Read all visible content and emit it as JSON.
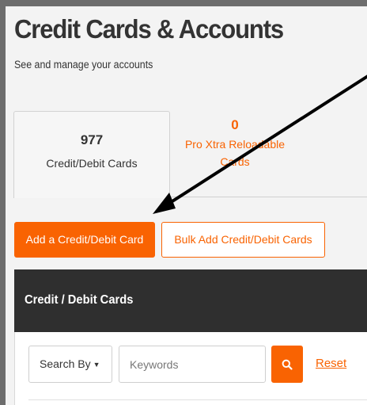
{
  "page": {
    "title": "Credit Cards & Accounts",
    "subtitle": "See and manage your accounts"
  },
  "tabs": [
    {
      "count": "977",
      "label": "Credit/Debit Cards",
      "active": true
    },
    {
      "count": "0",
      "label": "Pro Xtra Reloadable Cards",
      "active": false
    }
  ],
  "actions": {
    "add_label": "Add a Credit/Debit Card",
    "bulk_label": "Bulk Add Credit/Debit Cards"
  },
  "panel": {
    "title": "Credit / Debit Cards",
    "search_by_label": "Search By",
    "keywords_placeholder": "Keywords",
    "reset_label": "Reset"
  },
  "colors": {
    "accent": "#f96302",
    "header_bg": "#2f2f2f",
    "annotation_arrow": "#000000"
  },
  "icons": {
    "search": "search-icon",
    "caret": "caret-down-icon",
    "annotation": "arrow-annotation"
  }
}
